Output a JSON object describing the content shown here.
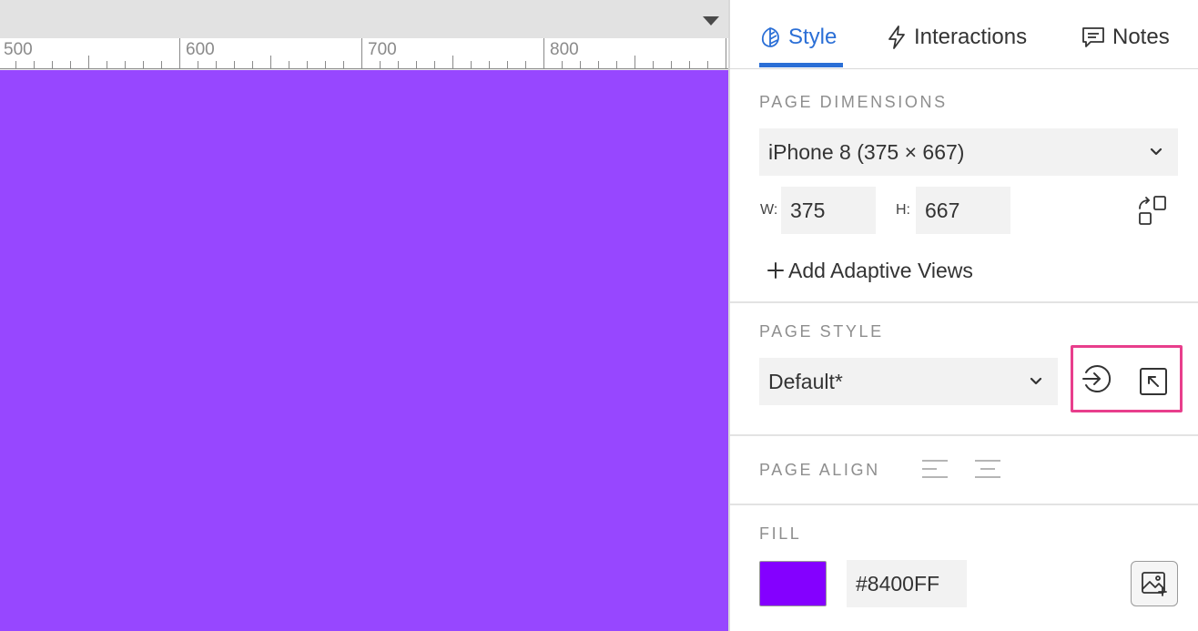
{
  "ruler": {
    "labels": [
      "500",
      "600",
      "700",
      "800"
    ]
  },
  "tabs": [
    {
      "label": "Style",
      "icon": "style-leaf-icon",
      "active": true
    },
    {
      "label": "Interactions",
      "icon": "lightning-icon",
      "active": false
    },
    {
      "label": "Notes",
      "icon": "note-icon",
      "active": false
    }
  ],
  "page_dimensions": {
    "title": "PAGE DIMENSIONS",
    "preset": "iPhone 8  (375 × 667)",
    "width_label": "W:",
    "width_value": "375",
    "height_label": "H:",
    "height_value": "667",
    "add_adaptive_label": "Add Adaptive Views"
  },
  "page_style": {
    "title": "PAGE STYLE",
    "value": "Default*"
  },
  "page_align": {
    "title": "PAGE ALIGN"
  },
  "fill": {
    "title": "FILL",
    "color_value": "#8400FF"
  },
  "colors": {
    "canvas": "#9747FF",
    "accent": "#2B6FD6",
    "highlight": "#E83E8C",
    "fill_swatch": "#8400FF"
  }
}
